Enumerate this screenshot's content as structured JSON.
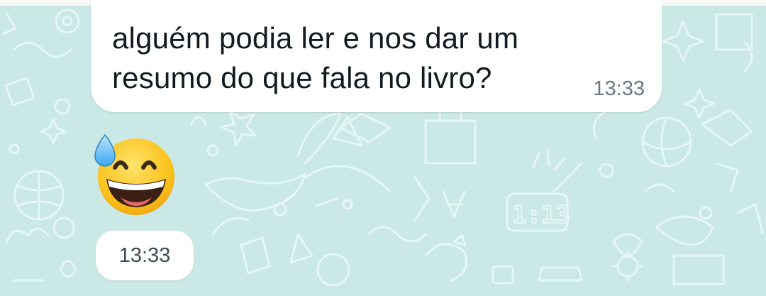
{
  "chat": {
    "wallpaper_color": "#c9e8e6",
    "doodle_color": "#e6f6f5",
    "messages": [
      {
        "type": "text",
        "text": "alguém podia ler e nos dar um resumo do que fala no livro?",
        "time": "13:33"
      },
      {
        "type": "emoji",
        "emoji_name": "grinning-face-with-sweat-icon",
        "time": "13:33"
      }
    ],
    "wallpaper_clock_text": "1:13"
  }
}
